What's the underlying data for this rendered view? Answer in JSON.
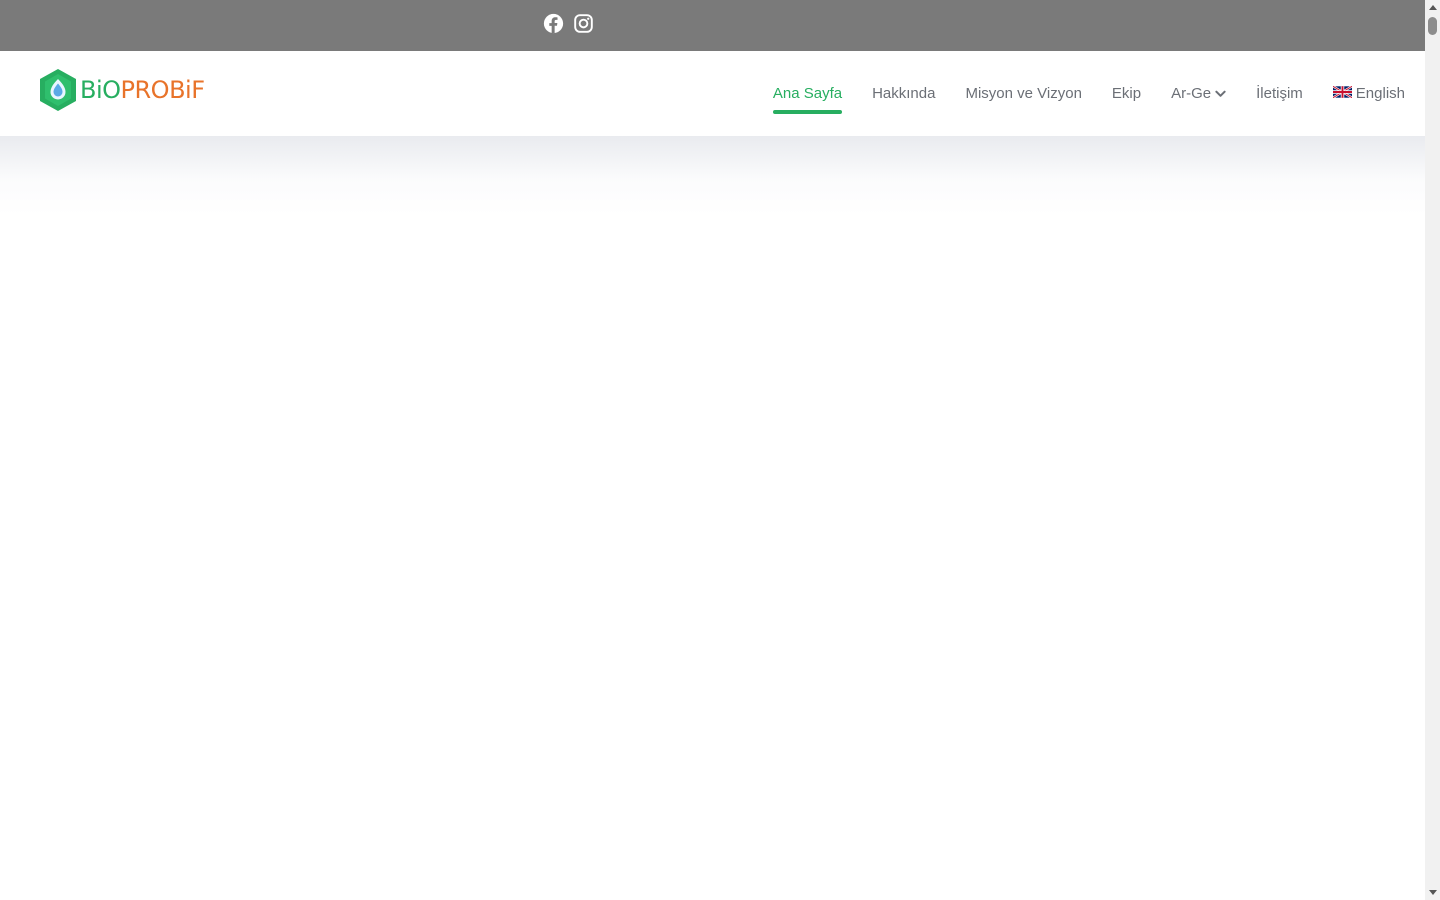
{
  "topbar": {
    "background": "#7a7a7a",
    "social": [
      {
        "icon": "facebook-icon"
      },
      {
        "icon": "instagram-icon"
      }
    ]
  },
  "header": {
    "logo": {
      "text_part1": "BiO",
      "text_part2": "PROBiF",
      "color_primary": "#27ae60",
      "color_secondary": "#e8732a"
    },
    "nav": {
      "home": "Ana Sayfa",
      "about": "Hakkında",
      "mission": "Misyon ve Vizyon",
      "team": "Ekip",
      "rnd": "Ar-Ge",
      "contact": "İletişim",
      "language": "English"
    },
    "active_item": "Ana Sayfa",
    "accent_color": "#27ae60",
    "text_color": "#6b6f76"
  }
}
